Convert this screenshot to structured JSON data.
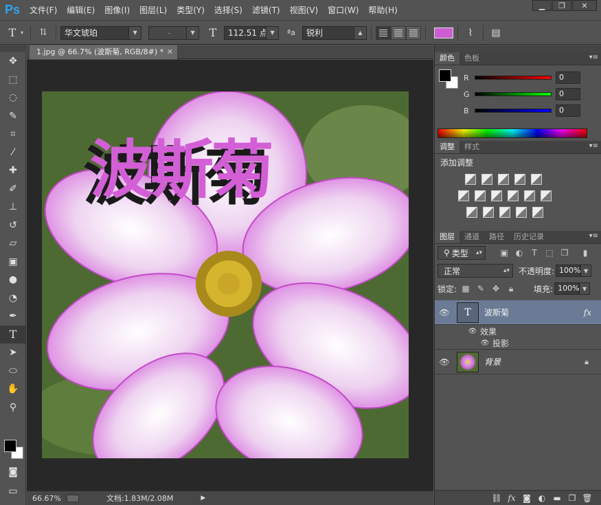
{
  "app": {
    "logo": "Ps"
  },
  "menu": [
    "文件(F)",
    "编辑(E)",
    "图像(I)",
    "图层(L)",
    "类型(Y)",
    "选择(S)",
    "滤镜(T)",
    "视图(V)",
    "窗口(W)",
    "帮助(H)"
  ],
  "window_controls": {
    "minimize": "▁",
    "maximize": "❐",
    "close": "✕"
  },
  "options": {
    "font_family": "华文琥珀",
    "font_style": "-",
    "font_size": "112.51 点",
    "aa_label": "ªa",
    "antialias": "锐利",
    "text_color": "#cc5ed1"
  },
  "document": {
    "tab_title": "1.jpg @ 66.7% (波斯菊, RGB/8#) *",
    "text_layer": "波斯菊",
    "text_color": "#d35fd6",
    "zoom": "66.67%",
    "doc_size": "文档:1.83M/2.08M"
  },
  "color_panel": {
    "tabs": [
      "颜色",
      "色板"
    ],
    "r_label": "R",
    "g_label": "G",
    "b_label": "B",
    "r": "0",
    "g": "0",
    "b": "0"
  },
  "adjust_panel": {
    "tabs": [
      "调整",
      "样式"
    ],
    "title": "添加调整"
  },
  "layers_panel": {
    "tabs": [
      "图层",
      "通道",
      "路径",
      "历史记录"
    ],
    "filter_kind": "类型",
    "blend_mode": "正常",
    "opacity_label": "不透明度:",
    "opacity": "100%",
    "lock_label": "锁定:",
    "fill_label": "填充:",
    "fill": "100%",
    "layers": [
      {
        "name": "波斯菊",
        "fx": "fx",
        "effects_label": "效果",
        "effect": "投影"
      },
      {
        "name": "背景"
      }
    ]
  }
}
